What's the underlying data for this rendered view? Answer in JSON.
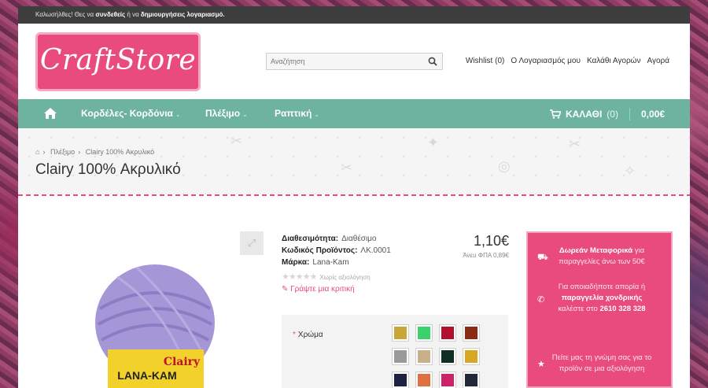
{
  "topbar": {
    "welcome": "Καλωσήλθες! Θες να",
    "login": "συνδεθείς",
    "or": "ή να",
    "register": "δημιουργήσεις λογαριασμό."
  },
  "logo": {
    "text": "CraftStore"
  },
  "search": {
    "placeholder": "Αναζήτηση"
  },
  "toplinks": [
    "Wishlist (0)",
    "Ο Λογαριασμός μου",
    "Καλάθι Αγορών",
    "Αγορά"
  ],
  "nav": {
    "items": [
      "Κορδέλες- Κορδόνια",
      "Πλέξιμο",
      "Ραπτική"
    ],
    "cart_label": "ΚΑΛΑΘΙ",
    "cart_count": "(0)",
    "cart_total": "0,00€"
  },
  "breadcrumb": {
    "items": [
      "Πλέξιμο",
      "Clairy 100% Ακρυλικό"
    ]
  },
  "page_title": "Clairy 100% Ακρυλικό",
  "product": {
    "availability_label": "Διαθεσιμότητα:",
    "availability_value": "Διαθέσιμο",
    "code_label": "Κωδικός Προϊόντος:",
    "code_value": "ΛΚ.0001",
    "brand_label": "Μάρκα:",
    "brand_value": "Lana-Kam",
    "no_reviews": "Χωρίς αξιολόγηση",
    "write_review": "Γράψτε μια κριτική",
    "price": "1,10€",
    "price_net": "Άνευ ΦΠΑ 0,89€",
    "yarn_brand": "Clairy",
    "yarn_maker": "LANA-KAM"
  },
  "options": {
    "color_label": "Χρώμα",
    "swatches": [
      "#c9a63a",
      "#3bd16b",
      "#b0102e",
      "#8a2c12",
      "#9a9a9a",
      "#c9b08a",
      "#0f2e24",
      "#d9a623",
      "#1c2340",
      "#e0703d",
      "#d0206a",
      "#222838"
    ]
  },
  "promo": {
    "shipping_bold": "Δωρεάν Μεταφορικά",
    "shipping_rest": "για παραγγελίες άνω των 50€",
    "wholesale_pre": "Για οποιαδήποτε απορία ή",
    "wholesale_bold": "παραγγελία χονδρικής",
    "wholesale_post": "καλέστε στο",
    "phone": "2610 328 328",
    "review_text": "Πείτε μας τη γνώμη σας για το προϊόν σε μια αξιολόγηση"
  },
  "colors": {
    "accent": "#e84b7c",
    "nav": "#6db39e"
  }
}
